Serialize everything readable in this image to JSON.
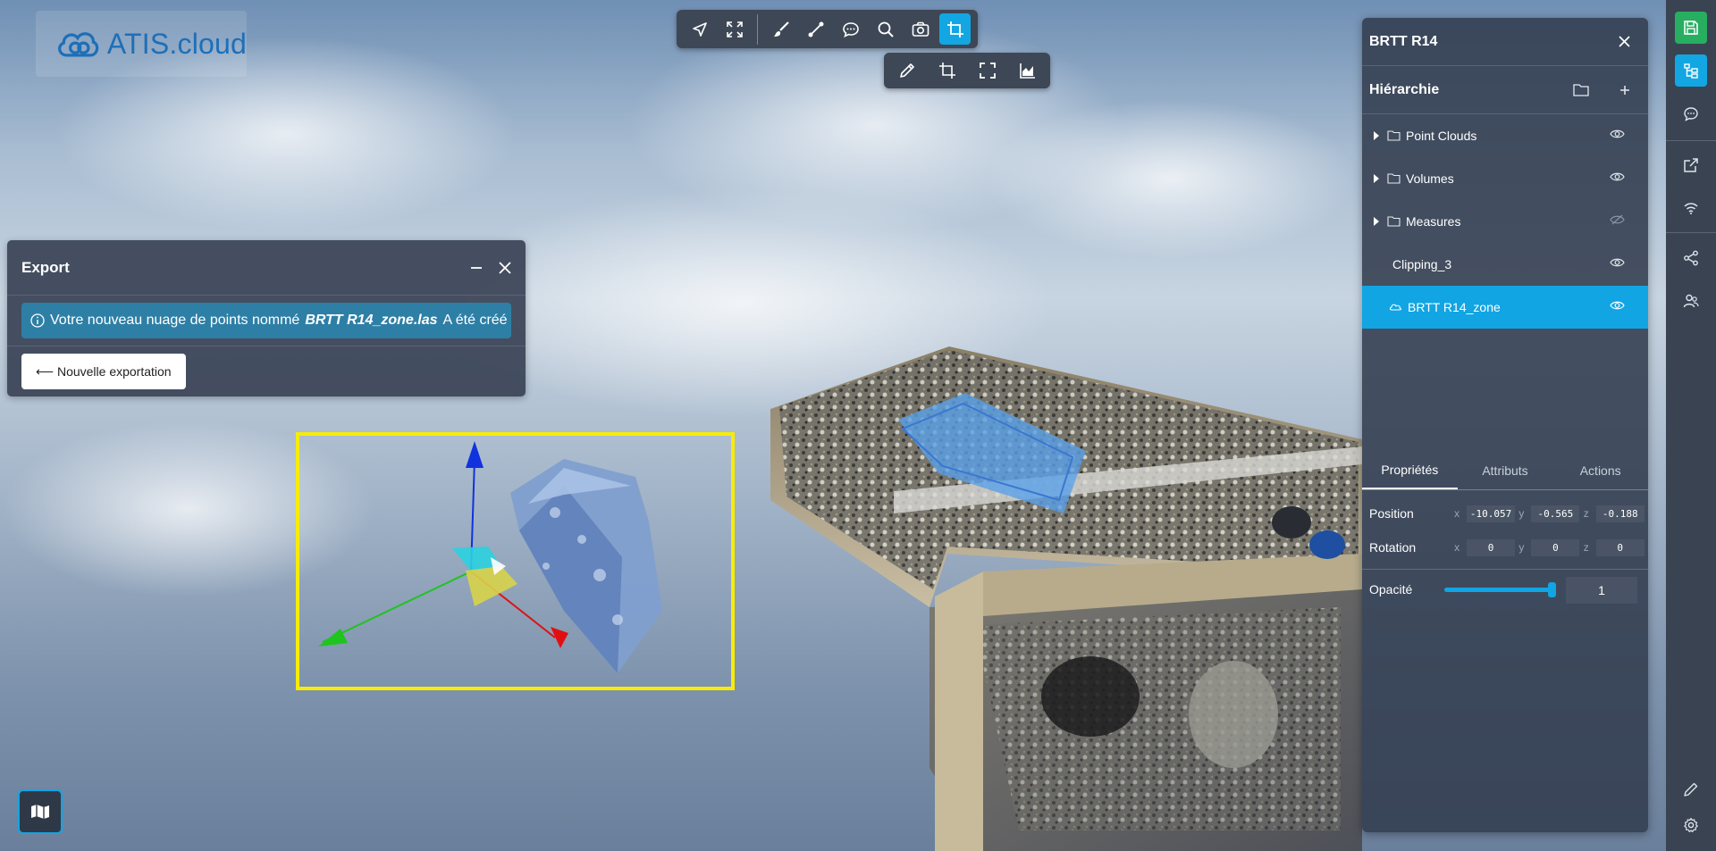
{
  "app": {
    "logo_text": "ATIS.cloud",
    "brand_color": "#1d6fb8",
    "accent_color": "#12a7e3",
    "selection_color": "#f7ec06"
  },
  "toolbar_main": {
    "tools": [
      {
        "icon": "navigate-icon",
        "active": false
      },
      {
        "icon": "fit-extent-icon",
        "active": false
      },
      {
        "icon": "brush-icon",
        "active": false
      },
      {
        "icon": "measure-line-icon",
        "active": false
      },
      {
        "icon": "comment-icon",
        "active": false
      },
      {
        "icon": "search-icon",
        "active": false
      },
      {
        "icon": "camera-icon",
        "active": false
      },
      {
        "icon": "crop-icon",
        "active": true
      }
    ]
  },
  "toolbar_sub": {
    "tools": [
      {
        "icon": "pencil-icon"
      },
      {
        "icon": "crop-icon"
      },
      {
        "icon": "fullscreen-icon"
      },
      {
        "icon": "area-chart-icon"
      }
    ]
  },
  "export_panel": {
    "title": "Export",
    "message_prefix": "Votre nouveau nuage de points nommé",
    "file_name": "BRTT R14_zone.las",
    "message_suffix": "A été créé",
    "new_export_label": "⟵ Nouvelle exportation"
  },
  "right_panel": {
    "title": "BRTT R14",
    "hierarchy_title": "Hiérarchie",
    "tree": [
      {
        "label": "Point Clouds",
        "has_children": true,
        "folder": true,
        "visible": true,
        "selected": false
      },
      {
        "label": "Volumes",
        "has_children": true,
        "folder": true,
        "visible": true,
        "selected": false
      },
      {
        "label": "Measures",
        "has_children": true,
        "folder": true,
        "visible": false,
        "selected": false
      },
      {
        "label": "Clipping_3",
        "has_children": false,
        "folder": false,
        "visible": true,
        "selected": false
      },
      {
        "label": "BRTT R14_zone",
        "has_children": false,
        "folder": false,
        "visible": true,
        "selected": true
      }
    ],
    "tabs": [
      "Propriétés",
      "Attributs",
      "Actions"
    ],
    "active_tab": 0,
    "position_label": "Position",
    "rotation_label": "Rotation",
    "opacity_label": "Opacité",
    "position": {
      "x": "-10.057",
      "y": "-0.565",
      "z": "-0.188"
    },
    "rotation": {
      "x": "0",
      "y": "0",
      "z": "0"
    },
    "axis_labels": {
      "x": "x",
      "y": "y",
      "z": "z"
    },
    "opacity": "1"
  },
  "sidebar": {
    "items": [
      {
        "icon": "save-icon",
        "active": true,
        "color": "#27ae60"
      },
      {
        "icon": "hierarchy-icon",
        "active": true,
        "color": "#12a7e3"
      },
      {
        "icon": "chat-icon"
      },
      {
        "icon": "external-link-icon"
      },
      {
        "icon": "wifi-icon"
      },
      {
        "icon": "share-icon"
      },
      {
        "icon": "users-icon"
      },
      {
        "icon": "edit-icon"
      },
      {
        "icon": "settings-icon"
      }
    ]
  }
}
